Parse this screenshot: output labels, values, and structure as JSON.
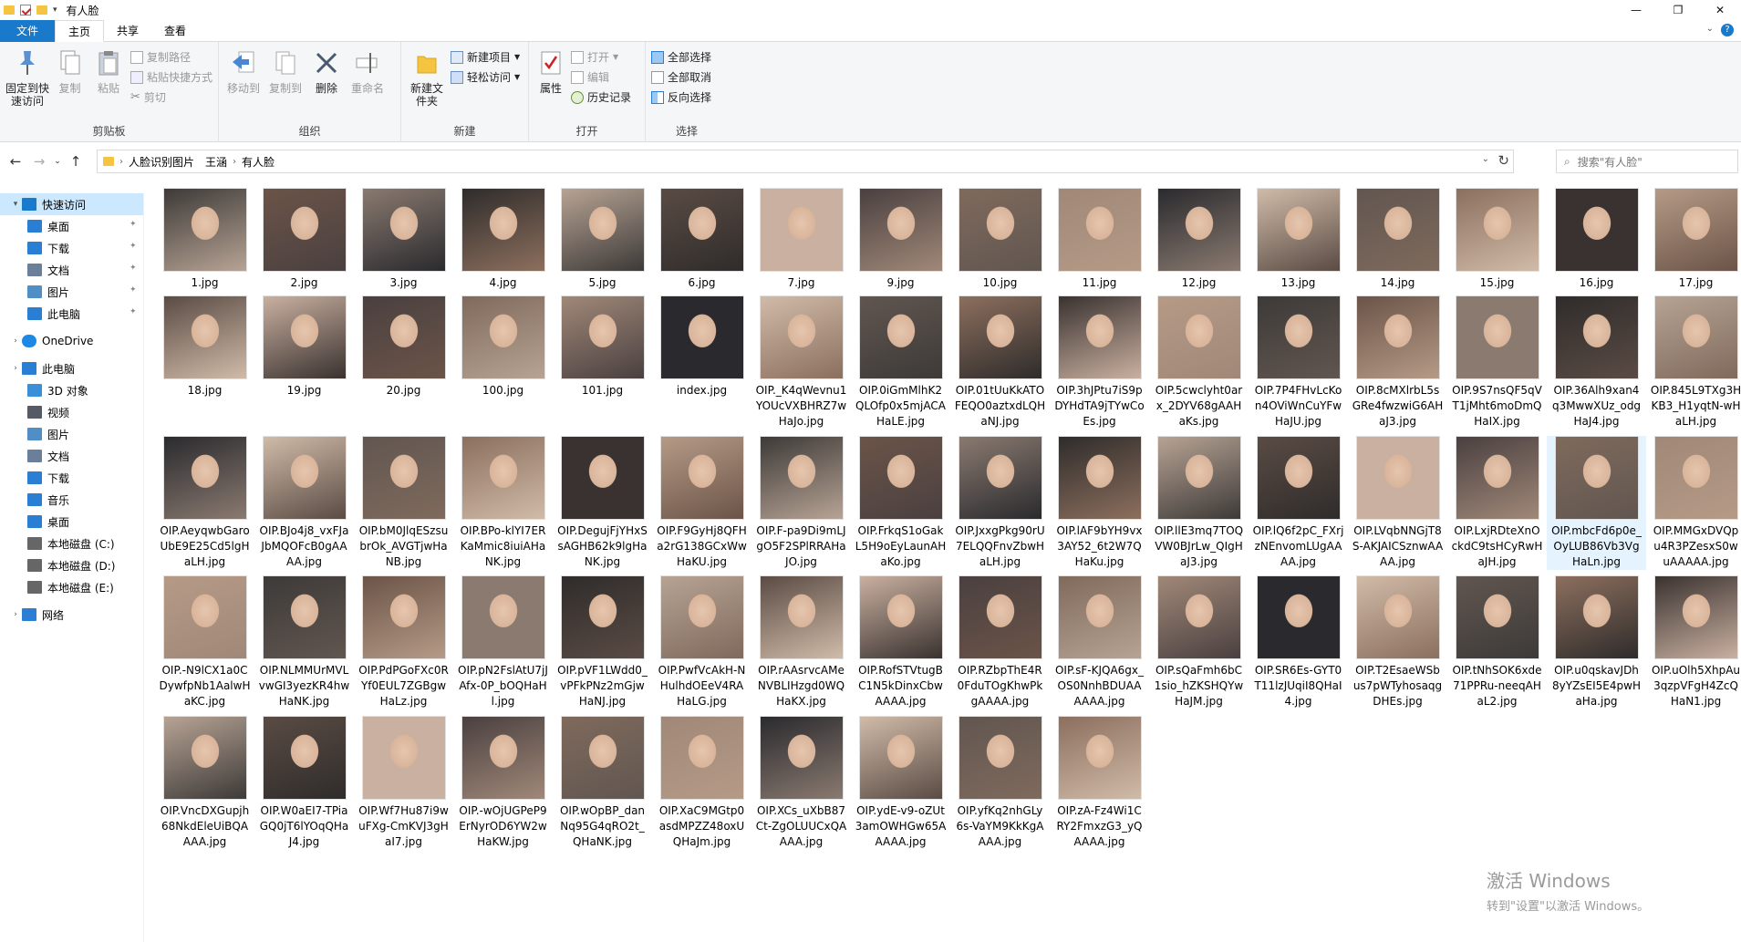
{
  "window": {
    "title": "有人脸",
    "controls": {
      "minimize": "—",
      "maximize": "❐",
      "close": "✕"
    }
  },
  "ribbon_tabs": [
    "文件",
    "主页",
    "共享",
    "查看"
  ],
  "ribbon": {
    "clipboard": {
      "label": "剪贴板",
      "pin": "固定到快速访问",
      "copy": "复制",
      "paste": "粘贴",
      "copy_path": "复制路径",
      "paste_shortcut": "粘贴快捷方式",
      "cut": "剪切"
    },
    "organize": {
      "label": "组织",
      "move_to": "移动到",
      "copy_to": "复制到",
      "delete": "删除",
      "rename": "重命名"
    },
    "new": {
      "label": "新建",
      "new_folder": "新建文件夹",
      "new_item": "新建项目",
      "easy_access": "轻松访问"
    },
    "open": {
      "label": "打开",
      "properties": "属性",
      "open": "打开",
      "edit": "编辑",
      "history": "历史记录"
    },
    "select": {
      "label": "选择",
      "select_all": "全部选择",
      "select_none": "全部取消",
      "invert": "反向选择"
    }
  },
  "address": {
    "breadcrumbs": [
      "人脸识别图片",
      "王涵",
      "有人脸"
    ],
    "search_placeholder": "搜索\"有人脸\""
  },
  "sidebar": {
    "items": [
      {
        "label": "快速访问",
        "icon": "star-icon",
        "color": "#1979ca",
        "level": 0,
        "selected": true,
        "pin": false
      },
      {
        "label": "桌面",
        "icon": "desktop-icon",
        "color": "#2a7fd4",
        "level": 1,
        "pin": true
      },
      {
        "label": "下载",
        "icon": "download-icon",
        "color": "#2a7fd4",
        "level": 1,
        "pin": true
      },
      {
        "label": "文档",
        "icon": "document-icon",
        "color": "#6a7f99",
        "level": 1,
        "pin": true
      },
      {
        "label": "图片",
        "icon": "picture-icon",
        "color": "#4f8fc6",
        "level": 1,
        "pin": true
      },
      {
        "label": "此电脑",
        "icon": "computer-icon",
        "color": "#2a7fd4",
        "level": 1,
        "pin": true
      },
      {
        "label": "OneDrive",
        "icon": "cloud-icon",
        "color": "#1e88e5",
        "level": 0,
        "pin": false
      },
      {
        "label": "此电脑",
        "icon": "computer-icon",
        "color": "#2a7fd4",
        "level": 0,
        "pin": false
      },
      {
        "label": "3D 对象",
        "icon": "cube-icon",
        "color": "#3b8ed8",
        "level": 1,
        "pin": false
      },
      {
        "label": "视频",
        "icon": "video-icon",
        "color": "#555a66",
        "level": 1,
        "pin": false
      },
      {
        "label": "图片",
        "icon": "picture-icon",
        "color": "#4f8fc6",
        "level": 1,
        "pin": false
      },
      {
        "label": "文档",
        "icon": "document-icon",
        "color": "#6a7f99",
        "level": 1,
        "pin": false
      },
      {
        "label": "下载",
        "icon": "download-icon",
        "color": "#2a7fd4",
        "level": 1,
        "pin": false
      },
      {
        "label": "音乐",
        "icon": "music-icon",
        "color": "#2a7fd4",
        "level": 1,
        "pin": false
      },
      {
        "label": "桌面",
        "icon": "desktop-icon",
        "color": "#2a7fd4",
        "level": 1,
        "pin": false
      },
      {
        "label": "本地磁盘 (C:)",
        "icon": "drive-icon",
        "color": "#666",
        "level": 1,
        "pin": false
      },
      {
        "label": "本地磁盘 (D:)",
        "icon": "drive-icon",
        "color": "#666",
        "level": 1,
        "pin": false
      },
      {
        "label": "本地磁盘 (E:)",
        "icon": "drive-icon",
        "color": "#666",
        "level": 1,
        "pin": false
      },
      {
        "label": "网络",
        "icon": "network-icon",
        "color": "#2a7fd4",
        "level": 0,
        "pin": false
      }
    ]
  },
  "files": [
    [
      "1.jpg",
      "2.jpg",
      "3.jpg",
      "4.jpg",
      "5.jpg",
      "6.jpg",
      "7.jpg",
      "9.jpg",
      "10.jpg",
      "11.jpg",
      "12.jpg",
      "13.jpg",
      "14.jpg",
      "15.jpg",
      "16.jpg",
      "17.jpg"
    ],
    [
      "18.jpg",
      "19.jpg",
      "20.jpg",
      "100.jpg",
      "101.jpg",
      "index.jpg",
      "OIP._K4qWevnu1YOUcVXBHRZ7wHaJo.jpg",
      "OIP.0iGmMlhK2QLOfp0x5mjACAHaLE.jpg",
      "OIP.01tUuKkATOFEQO0aztxdLQHaNJ.jpg",
      "OIP.3hJPtu7iS9pDYHdTA9jTYwCoEs.jpg",
      "OIP.5cwclyht0arx_2DYV68gAAHaKs.jpg",
      "OIP.7P4FHvLcKon4OViWnCuYFwHaJU.jpg",
      "OIP.8cMXlrbL5sGRe4fwzwiG6AHaJ3.jpg",
      "OIP.9S7nsQF5qVT1jMht6moDmQHaIX.jpg",
      "OIP.36Alh9xan4q3MwwXUz_odgHaJ4.jpg",
      "OIP.845L9TXg3HKB3_H1yqtN-wHaLH.jpg"
    ],
    [
      "OIP.AeyqwbGaroUbE9E25Cd5lgHaLH.jpg",
      "OIP.BJo4j8_vxFJaJbMQOFcB0gAAAA.jpg",
      "OIP.bM0JlqESzsubrOk_AVGTjwHaNB.jpg",
      "OIP.BPo-klYI7ERKaMmic8iuiAHaNK.jpg",
      "OIP.DegujFjYHxSsAGHB62k9lgHaNK.jpg",
      "OIP.F9GyHj8QFHa2rG138GCxWwHaKU.jpg",
      "OIP.F-pa9Di9mLJgO5F2SPlRRAHaJO.jpg",
      "OIP.FrkqS1oGakL5H9oEyLaunAHaKo.jpg",
      "OIP.JxxgPkg90rU7ELQQFnvZbwHaLH.jpg",
      "OIP.lAF9bYH9vx3AY52_6t2W7QHaKu.jpg",
      "OIP.llE3mq7TOQVW0BJrLw_QIgHaJ3.jpg",
      "OIP.lQ6f2pC_FXrjzNEnvomLUgAAAA.jpg",
      "OIP.LVqbNNGjT8S-AKJAICSznwAAAA.jpg",
      "OIP.LxjRDteXnOckdC9tsHCyRwHaJH.jpg",
      "OIP.mbcFd6p0e_OyLUB86Vb3VgHaLn.jpg",
      "OIP.MMGxDVQpu4R3PZesxS0wuAAAAA.jpg"
    ],
    [
      "OIP.-N9lCX1a0CDywfpNb1AalwHaKC.jpg",
      "OIP.NLMMUrMVLvwGI3yezKR4hwHaNK.jpg",
      "OIP.PdPGoFXc0RYf0EUL7ZGBgwHaLz.jpg",
      "OIP.pN2FslAtU7jJAfx-0P_bOQHaHl.jpg",
      "OIP.pVF1LWdd0_vPFkPNz2mGjwHaNJ.jpg",
      "OIP.PwfVcAkH-NHulhdOEeV4RAHaLG.jpg",
      "OIP.rAAsrvcAMeNVBLIHzgd0WQHaKX.jpg",
      "OIP.RofSTVtugBC1N5kDinxCbwAAAA.jpg",
      "OIP.RZbpThE4R0FduTOgKhwPkgAAAA.jpg",
      "OIP.sF-KJQA6gx_OS0NnhBDUAAAAAA.jpg",
      "OIP.sQaFmh6bC1sio_hZKSHQYwHaJM.jpg",
      "OIP.SR6Es-GYT0T11lzJUqiI8QHaI4.jpg",
      "OIP.T2EsaeWSbus7pWTyhosaqgDHEs.jpg",
      "OIP.tNhSOK6xde71PPRu-neeqAHaL2.jpg",
      "OIP.u0qskavJDh8yYZsEI5E4pwHaHa.jpg",
      "OIP.uOlh5XhpAu3qzpVFgH4ZcQHaN1.jpg"
    ],
    [
      "OIP.VncDXGupjh68NkdEleUiBQAAAA.jpg",
      "OIP.W0aEI7-TPiaGQ0jT6lYOqQHaJ4.jpg",
      "OIP.Wf7Hu87i9wuFXg-CmKVJ3gHaI7.jpg",
      "OIP.-wOjUGPeP9ErNyrOD6YW2wHaKW.jpg",
      "OIP.wOpBP_danNq95G4qRO2t_QHaNK.jpg",
      "OIP.XaC9MGtp0asdMPZZ48oxUQHaJm.jpg",
      "OIP.XCs_uXbB87Ct-ZgOLUUCxQAAAA.jpg",
      "OIP.ydE-v9-oZUt3amOWHGw65AAAAA.jpg",
      "OIP.yfKq2nhGLy6s-VaYM9KkKgAAAA.jpg",
      "OIP.zA-Fz4Wi1CRY2FmxzG3_yQAAAA.jpg"
    ]
  ],
  "selected_file": "OIP.mbcFd6p0e_OyLUB86Vb3VgHaLn.jpg",
  "watermark": {
    "line1": "激活 Windows",
    "line2": "转到\"设置\"以激活 Windows。"
  }
}
